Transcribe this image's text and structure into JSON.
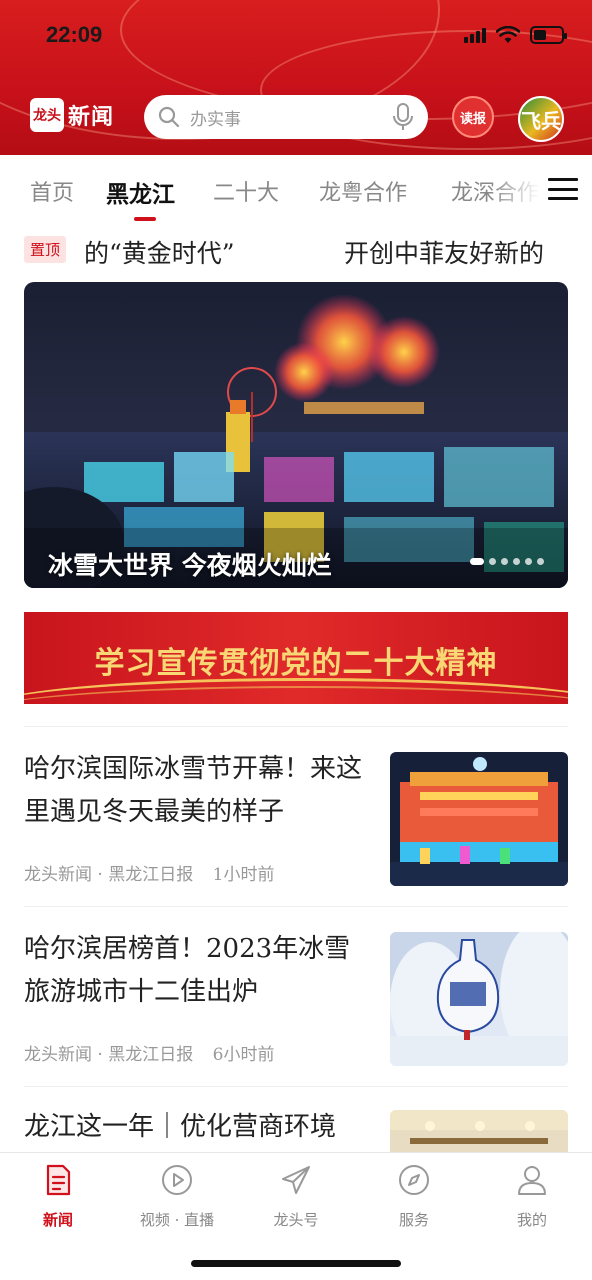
{
  "status_bar": {
    "time": "22:09"
  },
  "header": {
    "logo_mark": "龙头",
    "logo_text": "新闻",
    "search_placeholder": "办实事",
    "read_button": "读报",
    "avatar_text": "飞兵"
  },
  "tabs": [
    {
      "label": "首页",
      "active": false
    },
    {
      "label": "黑龙江",
      "active": true
    },
    {
      "label": "二十大",
      "active": false
    },
    {
      "label": "龙粤合作",
      "active": false
    },
    {
      "label": "龙深合作",
      "active": false
    }
  ],
  "pinned": {
    "badge": "置顶",
    "headline_1": "的“黄金时代”",
    "headline_2": "开创中菲友好新的"
  },
  "hero": {
    "caption": "冰雪大世界 今夜烟火灿烂",
    "slides_total": 6,
    "active_slide": 1
  },
  "banner": {
    "text": "学习宣传贯彻党的二十大精神"
  },
  "news": [
    {
      "title": "哈尔滨国际冰雪节开幕！来这里遇见冬天最美的样子",
      "source": "龙头新闻 · 黑龙江日报",
      "time": "1小时前",
      "thumb": "ice-palace-image"
    },
    {
      "title": "哈尔滨居榜首！2023年冰雪旅游城市十二佳出炉",
      "source": "龙头新闻 · 黑龙江日报",
      "time": "6小时前",
      "thumb": "snow-sculpture-vase-image"
    },
    {
      "title": "龙江这一年｜优化营商环境",
      "source": "",
      "time": "",
      "thumb": "conference-hall-image"
    }
  ],
  "bottom_nav": [
    {
      "label": "新闻",
      "icon": "news-icon",
      "active": true
    },
    {
      "label": "视频 · 直播",
      "icon": "video-play-icon",
      "active": false
    },
    {
      "label": "龙头号",
      "icon": "paper-plane-icon",
      "active": false
    },
    {
      "label": "服务",
      "icon": "compass-icon",
      "active": false
    },
    {
      "label": "我的",
      "icon": "user-icon",
      "active": false
    }
  ],
  "colors": {
    "brand_red": "#d0101a",
    "header_red": "#c7101a",
    "banner_gold": "#f9d774"
  }
}
